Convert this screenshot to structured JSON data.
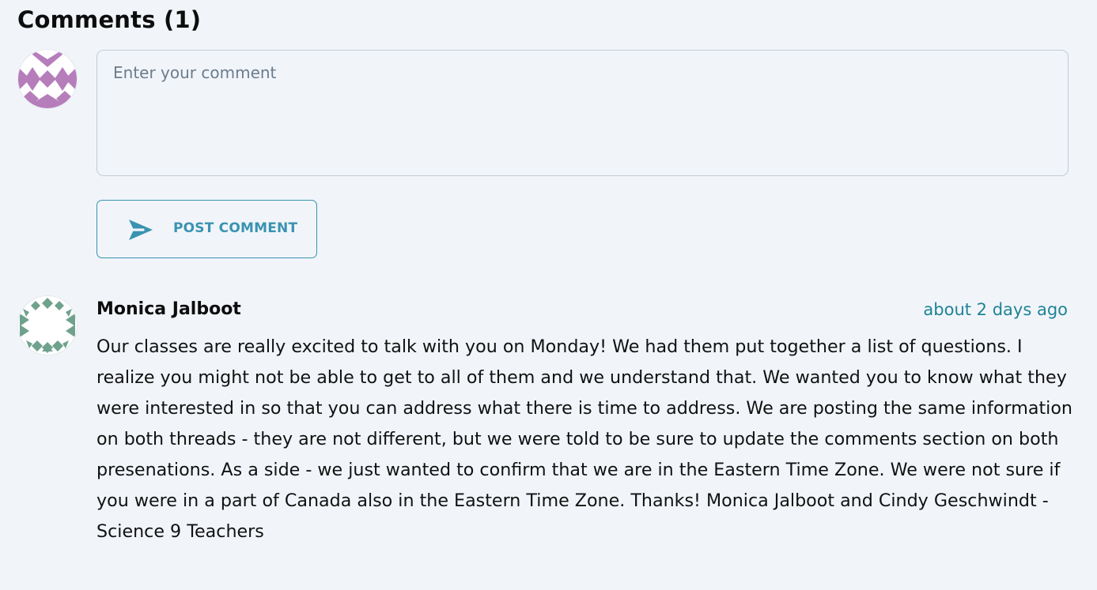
{
  "comments_section": {
    "title": "Comments (1)"
  },
  "new_comment": {
    "placeholder": "Enter your comment",
    "value": "",
    "post_label": "POST COMMENT",
    "post_icon": "send-icon"
  },
  "comments": [
    {
      "author": "Monica Jalboot",
      "timestamp": "about 2 days ago",
      "body": "Our classes are really excited to talk with you on Monday! We had them put together a list of questions. I realize you might not be able to get to all of them and we understand that. We wanted you to know what they were interested in so that you can address what there is time to address. We are posting the same information on both threads - they are not different, but we were told to be sure to update the comments section on both presenations. As a side - we just wanted to confirm that we are in the Eastern Time Zone. We were not sure if you were in a part of Canada also in the Eastern Time Zone. Thanks! Monica Jalboot and Cindy Geschwindt - Science 9 Teachers"
    }
  ],
  "colors": {
    "background": "#f1f5fa",
    "accent": "#3a93b0",
    "timestamp": "#1f8396",
    "avatar_me": "#b67dbb",
    "avatar_monica": "#6fa28d"
  }
}
